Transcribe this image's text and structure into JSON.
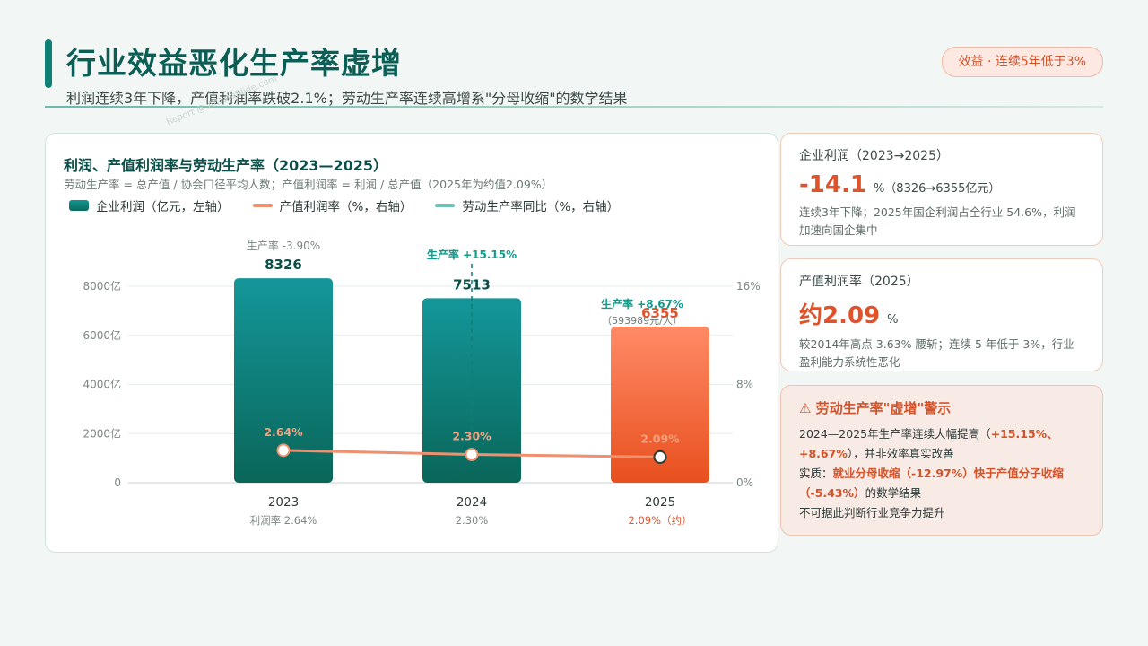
{
  "header": {
    "title": "行业效益恶化生产率虚增",
    "subtitle": "利润连续3年下降，产值利润率跌破2.1%；劳动生产率连续高增系\"分母收缩\"的数学结果",
    "badge": "效益 · 连续5年低于3%",
    "watermark": "Report @ AIDataSlide.com"
  },
  "chart_card": {
    "title": "利润、产值利润率与劳动生产率（2023—2025）",
    "subtitle": "劳动生产率 = 总产值 / 协会口径平均人数；产值利润率 = 利润 / 总产值（2025年为约值2.09%）",
    "legend": [
      "企业利润（亿元，左轴）",
      "产值利润率（%，右轴）",
      "劳动生产率同比（%，右轴）"
    ]
  },
  "chart_data": {
    "type": "bar",
    "categories": [
      "2023",
      "2024",
      "2025"
    ],
    "series": [
      {
        "name": "企业利润（亿元，左轴）",
        "values": [
          8326,
          7513,
          6355
        ]
      },
      {
        "name": "产值利润率（%，右轴）",
        "values": [
          2.64,
          2.3,
          2.09
        ]
      }
    ],
    "value_labels": [
      "8326",
      "7513",
      "6355"
    ],
    "rate_labels": [
      "2.64%",
      "2.30%",
      "2.09%"
    ],
    "productivity_labels": [
      "生产率 -3.90%",
      "生产率 +15.15%",
      "生产率 +8.67%"
    ],
    "productivity_note_2025": "（593989元/人）",
    "x_sublabels": [
      "利润率 2.64%",
      "2.30%",
      "2.09%（约）"
    ],
    "y_left_ticks": [
      "0",
      "2000亿",
      "4000亿",
      "6000亿",
      "8000亿"
    ],
    "y_right_ticks": [
      "0%",
      "8%",
      "16%"
    ],
    "ylim_left": [
      0,
      8000
    ],
    "ylim_right": [
      0,
      16
    ],
    "colors": {
      "bar": "#0e7f78",
      "bar_highlight": "#f0643a",
      "rate_line": "#f0906e",
      "productivity": "#6cc3b5",
      "text_dark": "#0a4f48"
    }
  },
  "kpi_cards": [
    {
      "label": "企业利润（2023→2025）",
      "value": "-14.1",
      "unit": "%（8326→6355亿元）",
      "note": "连续3年下降；2025年国企利润占全行业 54.6%，利润加速向国企集中"
    },
    {
      "label": "产值利润率（2025）",
      "value": "约2.09",
      "unit": "%",
      "note": "较2014年高点 3.63% 腰斩；连续 5 年低于 3%，行业盈利能力系统性恶化"
    }
  ],
  "warning": {
    "title": "⚠ 劳动生产率\"虚增\"警示",
    "line1a": "2024—2025年生产率连续大幅提高（",
    "line1b": "+15.15%、+8.67%",
    "line1c": "），并非效率真实改善",
    "line2a": "实质：",
    "line2b": "就业分母收缩（-12.97%）快于产值分子收缩（-5.43%）",
    "line2c": "的数学结果",
    "line3": "不可据此判断行业竞争力提升"
  }
}
